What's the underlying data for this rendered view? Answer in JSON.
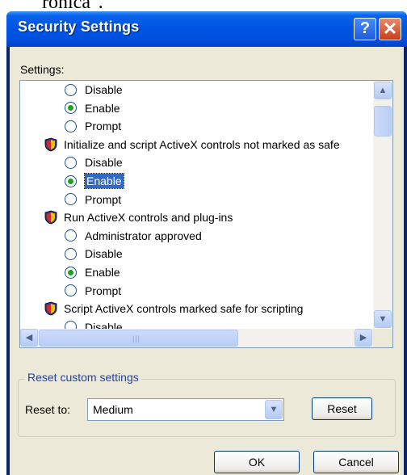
{
  "top_fragment": "ronica\".",
  "window": {
    "title": "Security Settings",
    "help_glyph": "?",
    "close_glyph": "✕"
  },
  "settings_label": "Settings:",
  "options": [
    {
      "kind": "radio",
      "label": "Disable",
      "checked": false
    },
    {
      "kind": "radio",
      "label": "Enable",
      "checked": true
    },
    {
      "kind": "radio",
      "label": "Prompt",
      "checked": false
    },
    {
      "kind": "header",
      "label": "Initialize and script ActiveX controls not marked as safe"
    },
    {
      "kind": "radio",
      "label": "Disable",
      "checked": false
    },
    {
      "kind": "radio",
      "label": "Enable",
      "checked": true,
      "selected": true
    },
    {
      "kind": "radio",
      "label": "Prompt",
      "checked": false
    },
    {
      "kind": "header",
      "label": "Run ActiveX controls and plug-ins"
    },
    {
      "kind": "radio",
      "label": "Administrator approved",
      "checked": false
    },
    {
      "kind": "radio",
      "label": "Disable",
      "checked": false
    },
    {
      "kind": "radio",
      "label": "Enable",
      "checked": true
    },
    {
      "kind": "radio",
      "label": "Prompt",
      "checked": false
    },
    {
      "kind": "header",
      "label": "Script ActiveX controls marked safe for scripting"
    },
    {
      "kind": "radio",
      "label": "Disable",
      "checked": false
    }
  ],
  "reset_group": {
    "legend": "Reset custom settings",
    "reset_to_label": "Reset to:",
    "selected_value": "Medium",
    "reset_button": "Reset"
  },
  "buttons": {
    "ok": "OK",
    "cancel": "Cancel"
  },
  "colors": {
    "titlebar": "#0054e3",
    "selection": "#316ac5",
    "radio_dot": "#21a121",
    "legend_text": "#1e3fb0"
  }
}
